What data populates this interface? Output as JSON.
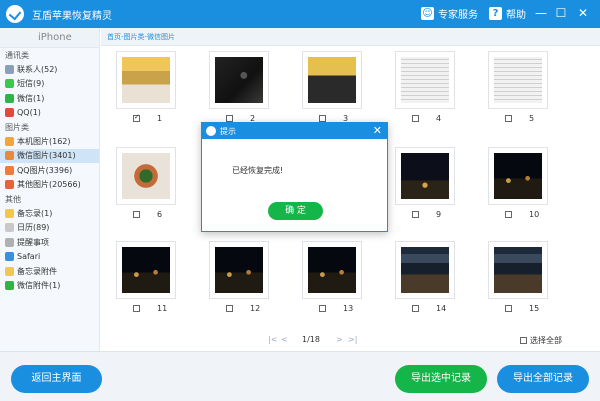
{
  "window": {
    "title": "互盾苹果恢复精灵",
    "expert_service": "专家服务",
    "help": "帮助",
    "minimize": "—",
    "maximize": "☐",
    "close": "✕"
  },
  "sidebar": {
    "device": "iPhone",
    "categories": [
      {
        "label": "通讯类",
        "items": [
          {
            "label": "联系人(52)",
            "color": "#8aa0b8"
          },
          {
            "label": "短信(9)",
            "color": "#3cc84c"
          },
          {
            "label": "微信(1)",
            "color": "#2fb545"
          },
          {
            "label": "QQ(1)",
            "color": "#e04a3a"
          }
        ]
      },
      {
        "label": "图片类",
        "items": [
          {
            "label": "本机图片(162)",
            "color": "#f2a53a"
          },
          {
            "label": "微信图片(3401)",
            "color": "#e88a3a",
            "active": true
          },
          {
            "label": "QQ图片(3396)",
            "color": "#f07a3a"
          },
          {
            "label": "其他图片(20566)",
            "color": "#e0673a"
          }
        ]
      },
      {
        "label": "其他",
        "items": [
          {
            "label": "备忘录(1)",
            "color": "#f2c84a"
          },
          {
            "label": "日历(89)",
            "color": "#c9c9c9"
          },
          {
            "label": "提醒事项",
            "color": "#b0b0b0"
          },
          {
            "label": "Safari",
            "color": "#3a8fe0"
          },
          {
            "label": "备忘录附件",
            "color": "#f2c84a"
          },
          {
            "label": "微信附件(1)",
            "color": "#2fb545"
          }
        ]
      }
    ]
  },
  "breadcrumb": "首页-图片类-微信图片",
  "photos": [
    {
      "n": "1",
      "checked": true,
      "style": "img-cat"
    },
    {
      "n": "2",
      "checked": false,
      "style": "img-dark"
    },
    {
      "n": "3",
      "checked": false,
      "style": "img-gold"
    },
    {
      "n": "4",
      "checked": false,
      "style": "img-paper"
    },
    {
      "n": "5",
      "checked": false,
      "style": "img-paper"
    },
    {
      "n": "6",
      "checked": false,
      "style": "img-food"
    },
    {
      "n": "",
      "checked": false,
      "style": "img-night",
      "hidden": true
    },
    {
      "n": "",
      "checked": false,
      "style": "img-night",
      "hidden": true
    },
    {
      "n": "9",
      "checked": false,
      "style": "img-night"
    },
    {
      "n": "10",
      "checked": false,
      "style": "img-city"
    },
    {
      "n": "11",
      "checked": false,
      "style": "img-city"
    },
    {
      "n": "12",
      "checked": false,
      "style": "img-city"
    },
    {
      "n": "13",
      "checked": false,
      "style": "img-city"
    },
    {
      "n": "14",
      "checked": false,
      "style": "img-phone"
    },
    {
      "n": "15",
      "checked": false,
      "style": "img-phone"
    }
  ],
  "pager": {
    "first": "|<",
    "prev": "<",
    "page": "1/18",
    "next": ">",
    "last": ">|"
  },
  "select_all": "选择全部",
  "buttons": {
    "back": "返回主界面",
    "export_selected": "导出选中记录",
    "export_all": "导出全部记录"
  },
  "dialog": {
    "title": "提示",
    "message": "已经恢复完成!",
    "ok": "确 定",
    "close": "✕"
  }
}
